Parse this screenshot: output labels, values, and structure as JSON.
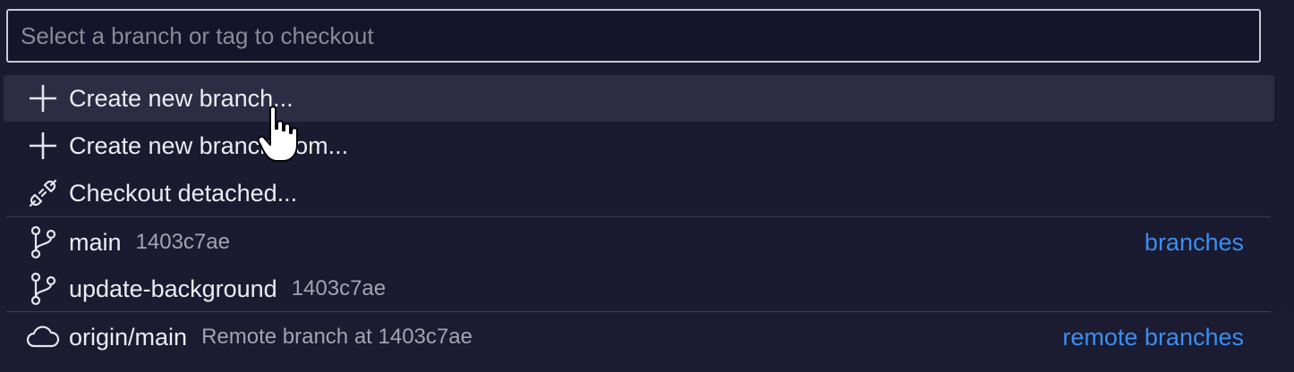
{
  "search": {
    "placeholder": "Select a branch or tag to checkout",
    "value": ""
  },
  "actions": [
    {
      "label": "Create new branch...",
      "icon": "plus-icon"
    },
    {
      "label": "Create new branch from...",
      "icon": "plus-icon"
    },
    {
      "label": "Checkout detached...",
      "icon": "detached-link-icon"
    }
  ],
  "branches": {
    "group_label": "branches",
    "items": [
      {
        "name": "main",
        "commit": "1403c7ae",
        "icon": "git-branch-icon"
      },
      {
        "name": "update-background",
        "commit": "1403c7ae",
        "icon": "git-branch-icon"
      }
    ]
  },
  "remote_branches": {
    "group_label": "remote branches",
    "items": [
      {
        "name": "origin/main",
        "description": "Remote branch at 1403c7ae",
        "icon": "cloud-icon"
      }
    ]
  },
  "colors": {
    "background": "#1a1a2e",
    "hover": "#2c2c44",
    "link": "#3a8ef0",
    "border": "#c9c9d6"
  }
}
